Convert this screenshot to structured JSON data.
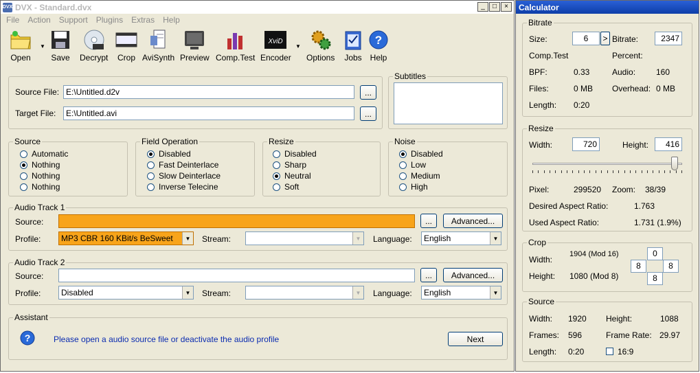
{
  "main": {
    "title": "DVX - Standard.dvx",
    "icon_text": "DVX",
    "window_buttons": {
      "minimize": "_",
      "maximize": "□",
      "close": "×"
    },
    "menu": [
      "File",
      "Action",
      "Support",
      "Plugins",
      "Extras",
      "Help"
    ],
    "toolbar": [
      {
        "label": "Open",
        "icon": "folder-icon"
      },
      {
        "label": "Save",
        "icon": "floppy-icon"
      },
      {
        "label": "Decrypt",
        "icon": "dvd-icon"
      },
      {
        "label": "Crop",
        "icon": "crop-icon"
      },
      {
        "label": "AviSynth",
        "icon": "script-icon"
      },
      {
        "label": "Preview",
        "icon": "monitor-icon"
      },
      {
        "label": "Comp.Test",
        "icon": "bar-chart-icon"
      },
      {
        "label": "Encoder",
        "icon": "xvid-icon"
      },
      {
        "label": "Options",
        "icon": "gears-icon"
      },
      {
        "label": "Jobs",
        "icon": "checklist-icon"
      },
      {
        "label": "Help",
        "icon": "help-icon"
      }
    ],
    "files": {
      "source_label": "Source File:",
      "source_value": "E:\\Untitled.d2v",
      "target_label": "Target File:",
      "target_value": "E:\\Untitled.avi",
      "browse": "..."
    },
    "subtitles_title": "Subtitles",
    "source": {
      "title": "Source",
      "options": [
        "Automatic",
        "Nothing",
        "Nothing",
        "Nothing"
      ],
      "selected": 1
    },
    "field_operation": {
      "title": "Field Operation",
      "options": [
        "Disabled",
        "Fast Deinterlace",
        "Slow Deinterlace",
        "Inverse Telecine"
      ],
      "selected": 0
    },
    "resize": {
      "title": "Resize",
      "options": [
        "Disabled",
        "Sharp",
        "Neutral",
        "Soft"
      ],
      "selected": 2
    },
    "noise": {
      "title": "Noise",
      "options": [
        "Disabled",
        "Low",
        "Medium",
        "High"
      ],
      "selected": 0
    },
    "audio1": {
      "title": "Audio Track 1",
      "source_label": "Source:",
      "source_value": "",
      "browse": "...",
      "advanced": "Advanced...",
      "profile_label": "Profile:",
      "profile_value": "MP3 CBR 160 KBit/s BeSweet",
      "stream_label": "Stream:",
      "stream_value": "",
      "language_label": "Language:",
      "language_value": "English",
      "highlight": "#f8a41a"
    },
    "audio2": {
      "title": "Audio Track 2",
      "source_label": "Source:",
      "source_value": "",
      "browse": "...",
      "advanced": "Advanced...",
      "profile_label": "Profile:",
      "profile_value": "Disabled",
      "stream_label": "Stream:",
      "stream_value": "",
      "language_label": "Language:",
      "language_value": "English"
    },
    "assistant": {
      "title": "Assistant",
      "message": "Please open a audio source file or deactivate the audio profile",
      "next": "Next",
      "message_color": "#0a2bb0"
    }
  },
  "calculator": {
    "title": "Calculator",
    "bitrate": {
      "title": "Bitrate",
      "size_label": "Size:",
      "size_value": "6",
      "arrow": ">",
      "bitrate_label": "Bitrate:",
      "bitrate_value": "2347",
      "comptest_label": "Comp.Test",
      "percent_label": "Percent:",
      "bpf_label": "BPF:",
      "bpf_value": "0.33",
      "audio_label": "Audio:",
      "audio_value": "160",
      "files_label": "Files:",
      "files_value": "0 MB",
      "overhead_label": "Overhead:",
      "overhead_value": "0 MB",
      "length_label": "Length:",
      "length_value": "0:20"
    },
    "resize": {
      "title": "Resize",
      "width_label": "Width:",
      "width_value": "720",
      "height_label": "Height:",
      "height_value": "416",
      "slider_level": 0.97,
      "pixel_label": "Pixel:",
      "pixel_value": "299520",
      "zoom_label": "Zoom:",
      "zoom_value": "38/39",
      "desired_label": "Desired Aspect Ratio:",
      "desired_value": "1.763",
      "used_label": "Used Aspect Ratio:",
      "used_value": "1.731 (1.9%)"
    },
    "crop": {
      "title": "Crop",
      "width_label": "Width:",
      "width_value": "1904 (Mod 16)",
      "height_label": "Height:",
      "height_value": "1080 (Mod 8)",
      "top": "0",
      "left": "8",
      "right": "8",
      "bottom": "8"
    },
    "source": {
      "title": "Source",
      "width_label": "Width:",
      "width_value": "1920",
      "height_label": "Height:",
      "height_value": "1088",
      "frames_label": "Frames:",
      "frames_value": "596",
      "framerate_label": "Frame Rate:",
      "framerate_value": "29.97",
      "length_label": "Length:",
      "length_value": "0:20",
      "ratio_label": "16:9"
    }
  }
}
